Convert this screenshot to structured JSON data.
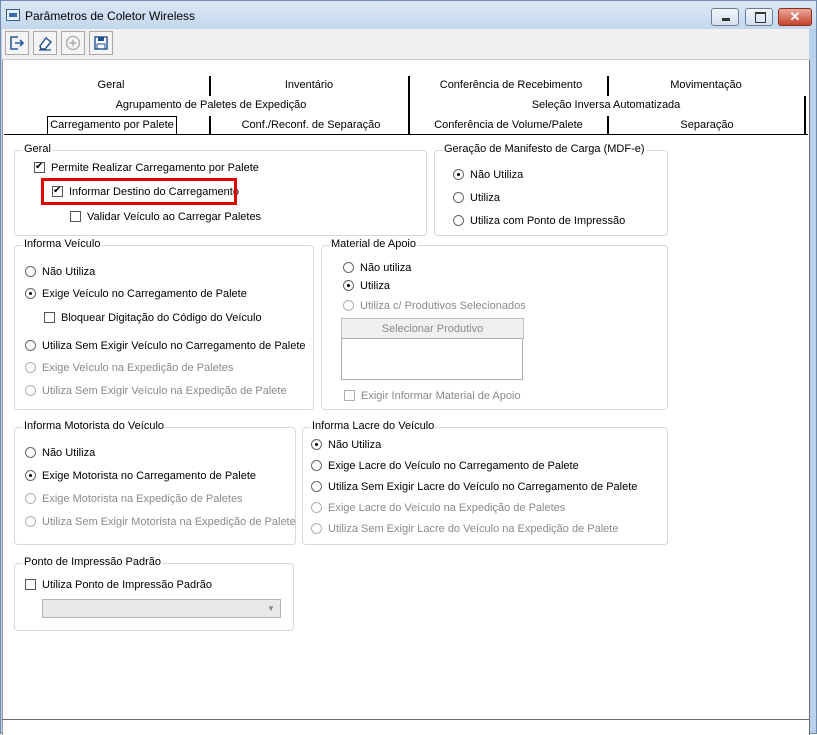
{
  "window": {
    "title": "Parâmetros de Coletor Wireless"
  },
  "titlebar_buttons": {
    "minimize": "–",
    "maximize": "□",
    "close": "✕"
  },
  "toolbar": {
    "icons": [
      "exit-icon",
      "eraser-icon",
      "add-icon",
      "save-icon"
    ]
  },
  "tabs": {
    "row1": [
      "Geral",
      "Inventário",
      "Conferência de Recebimento",
      "Movimentação"
    ],
    "row2": [
      "Agrupamento de Paletes de Expedição",
      "Seleção Inversa Automatizada"
    ],
    "row3": [
      "Carregamento por Palete",
      "Conf./Reconf. de Separação",
      "Conferência de Volume/Palete",
      "Separação"
    ],
    "active": "Carregamento por Palete"
  },
  "geral": {
    "title": "Geral",
    "permite": {
      "label": "Permite Realizar Carregamento por Palete",
      "checked": true
    },
    "informar": {
      "label": "Informar Destino do Carregamento",
      "checked": true
    },
    "validar": {
      "label": "Validar Veículo ao Carregar Paletes",
      "checked": false
    }
  },
  "manifesto": {
    "title": "Geração de Manifesto de Carga (MDF-e)",
    "options": [
      "Não Utiliza",
      "Utiliza",
      "Utiliza com Ponto de Impressão"
    ],
    "selected": "Não Utiliza"
  },
  "informa_veiculo": {
    "title": "Informa Veículo",
    "opt1": "Não Utiliza",
    "opt2": "Exige Veículo no Carregamento de Palete",
    "bloquear": "Bloquear Digitação do Código do Veículo",
    "opt3": "Utiliza Sem Exigir Veículo no Carregamento de Palete",
    "opt4": "Exige Veículo na Expedição de Paletes",
    "opt5": "Utiliza Sem Exigir Veículo na Expedição de Palete",
    "selected": "Exige Veículo no Carregamento de Palete"
  },
  "material_apoio": {
    "title": "Material de Apoio",
    "opt1": "Não utiliza",
    "opt2": "Utiliza",
    "opt3": "Utiliza c/ Produtivos Selecionados",
    "button": "Selecionar Produtivo",
    "exigir": "Exigir Informar Material de Apoio",
    "selected": "Utiliza"
  },
  "motorista": {
    "title": "Informa Motorista do Veículo",
    "opt1": "Não Utiliza",
    "opt2": "Exige Motorista no Carregamento de Palete",
    "opt3": "Exige Motorista na Expedição de Paletes",
    "opt4": "Utiliza Sem Exigir Motorista na Expedição de Palete",
    "selected": "Exige Motorista no Carregamento de Palete"
  },
  "lacre": {
    "title": "Informa Lacre do Veículo",
    "opt1": "Não Utiliza",
    "opt2": "Exige Lacre do Veículo no Carregamento de Palete",
    "opt3": "Utiliza Sem Exigir Lacre do Veículo no Carregamento de Palete",
    "opt4": "Exige Lacre do Veículo na Expedição de Paletes",
    "opt5": "Utiliza Sem Exigir Lacre do Veículo na Expedição de Palete",
    "selected": "Não Utiliza"
  },
  "ponto_impressao": {
    "title": "Ponto de Impressão Padrão",
    "check": "Utiliza Ponto de Impressão Padrão",
    "checked": false,
    "combo_value": ""
  },
  "colors": {
    "highlight": "#e00000",
    "title_bar": "#c4d7ee",
    "close_button": "#c7422c"
  }
}
